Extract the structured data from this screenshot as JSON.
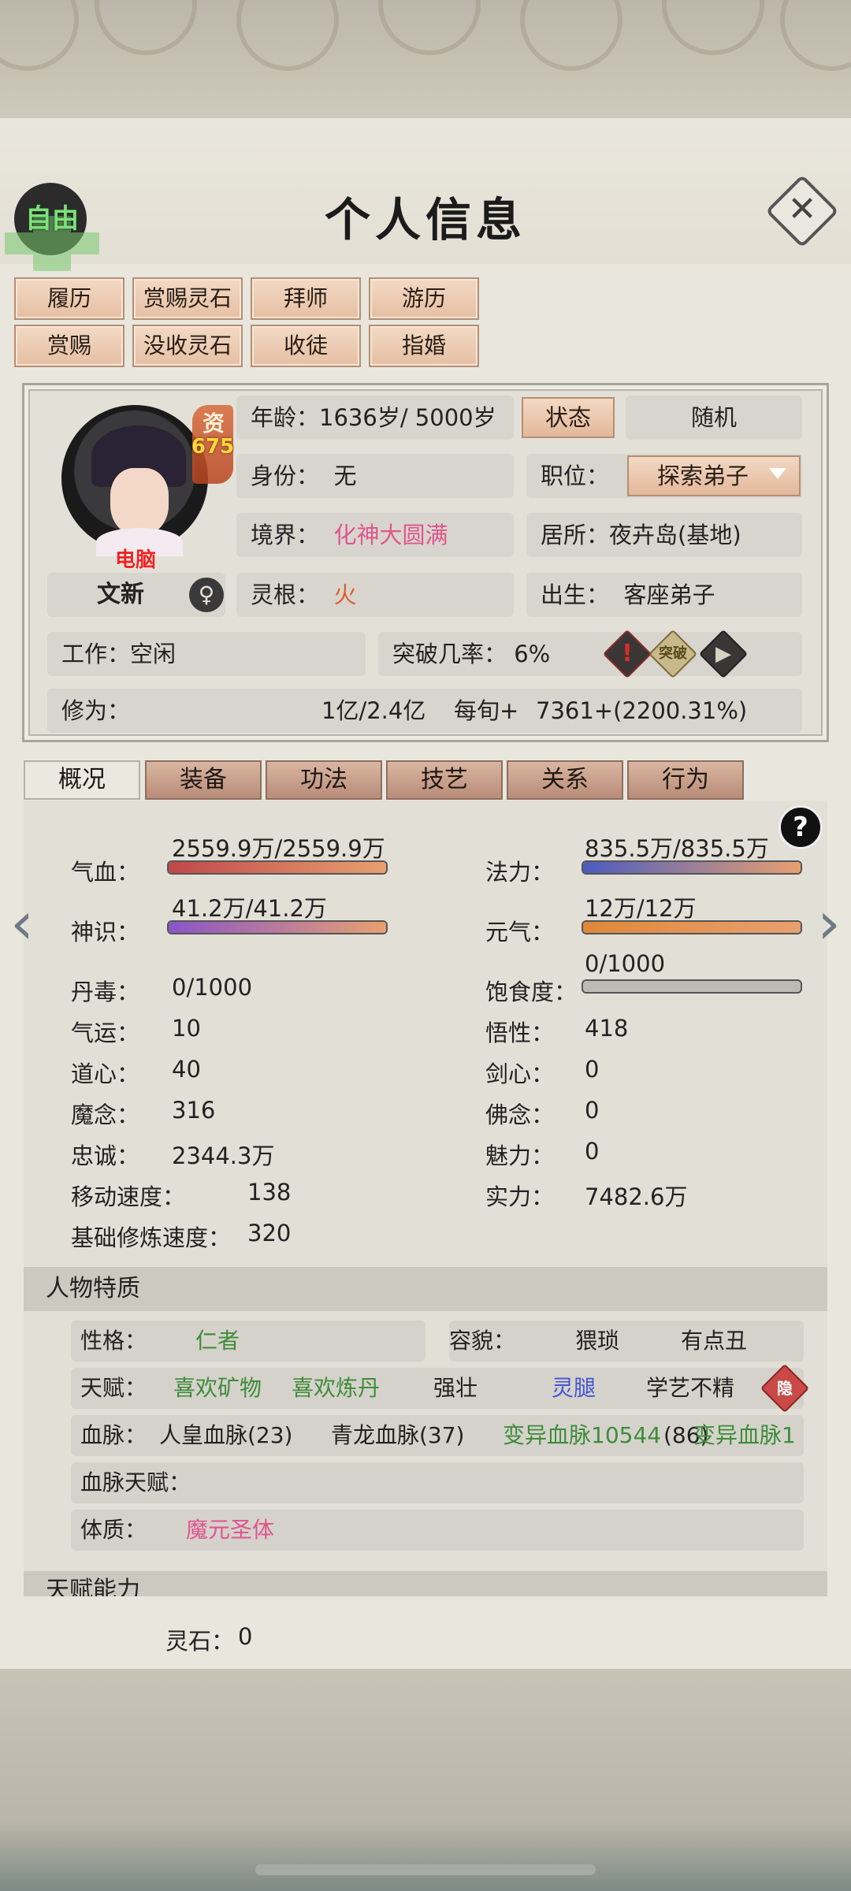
{
  "header": {
    "title": "个人信息",
    "free_badge": "自由",
    "close_icon": "close-x"
  },
  "actions": [
    {
      "label": "履历"
    },
    {
      "label": "赏赐灵石"
    },
    {
      "label": "拜师"
    },
    {
      "label": "游历"
    },
    {
      "label": "赏赐"
    },
    {
      "label": "没收灵石"
    },
    {
      "label": "收徒"
    },
    {
      "label": "指婚"
    }
  ],
  "profile": {
    "aptitude_char": "资",
    "aptitude_value": "675",
    "tag": "电脑",
    "name": "文新",
    "gender_icon": "♀",
    "age_label": "年龄：",
    "age_value": "1636岁/ 5000岁",
    "status_button": "状态",
    "random_button": "随机",
    "identity_label": "身份：",
    "identity_value": "无",
    "position_label": "职位：",
    "position_value": "探索弟子",
    "realm_label": "境界：",
    "realm_value": "化神大圆满",
    "residence_label": "居所：",
    "residence_value": "夜卉岛(基地)",
    "root_label": "灵根：",
    "root_value": "火",
    "origin_label": "出生：",
    "origin_value": "客座弟子",
    "work_label": "工作：",
    "work_value": "空闲",
    "breakthrough_label": "突破几率：",
    "breakthrough_value": "6%",
    "cultivation_label": "修为：",
    "cultivation_value": "1亿/2.4亿",
    "per_turn_label": "每旬+",
    "per_turn_value": "7361+(2200.31%)",
    "warning_icon": "!",
    "scroll_icon": "突破",
    "play_icon": "▶"
  },
  "tabs": [
    {
      "label": "概况"
    },
    {
      "label": "装备"
    },
    {
      "label": "功法"
    },
    {
      "label": "技艺"
    },
    {
      "label": "关系"
    },
    {
      "label": "行为"
    }
  ],
  "stats": {
    "help": "?",
    "hp_label": "气血：",
    "hp_text": "2559.9万/2559.9万",
    "hp_fraction": 1.0,
    "mana_label": "法力：",
    "mana_text": "835.5万/835.5万",
    "mana_fraction": 1.0,
    "sense_label": "神识：",
    "sense_text": "41.2万/41.2万",
    "sense_fraction": 1.0,
    "vital_label": "元气：",
    "vital_text": "12万/12万",
    "vital_fraction": 1.0,
    "poison_label": "丹毒：",
    "poison_value": "0/1000",
    "satiety_label": "饱食度：",
    "satiety_text": "0/1000",
    "satiety_fraction": 0,
    "luck_label": "气运：",
    "luck_value": "10",
    "comprehension_label": "悟性：",
    "comprehension_value": "418",
    "dao_label": "道心：",
    "dao_value": "40",
    "sword_label": "剑心：",
    "sword_value": "0",
    "demon_label": "魔念：",
    "demon_value": "316",
    "buddha_label": "佛念：",
    "buddha_value": "0",
    "loyalty_label": "忠诚：",
    "loyalty_value": "2344.3万",
    "charm_label": "魅力：",
    "charm_value": "0",
    "speed_label": "移动速度：",
    "speed_value": "138",
    "power_label": "实力：",
    "power_value": "7482.6万",
    "base_speed_label": "基础修炼速度：",
    "base_speed_value": "320",
    "colors": {
      "hp": "#c0484a",
      "mana": "#4c5cc0",
      "sense": "#8a55c8",
      "vital": "#e0883a"
    }
  },
  "traits": {
    "section_title": "人物特质",
    "personality_label": "性格：",
    "personality_value": "仁者",
    "appearance_label": "容貌：",
    "appearance_value_1": "猥琐",
    "appearance_value_2": "有点丑",
    "talent_label": "天赋：",
    "talent_1": "喜欢矿物",
    "talent_2": "喜欢炼丹",
    "talent_3": "强壮",
    "talent_4": "灵腿",
    "talent_5": "学艺不精",
    "hidden_icon": "隐",
    "bloodline_label": "血脉：",
    "bloodline_1": "人皇血脉(23)",
    "bloodline_2": "青龙血脉(37)",
    "bloodline_3": "变异血脉10544",
    "bloodline_4": "(86)",
    "bloodline_5": "变异血脉1",
    "bloodline_talent_label": "血脉天赋：",
    "physique_label": "体质：",
    "physique_value": "魔元圣体",
    "next_section": "天赋能力"
  },
  "footer": {
    "spirit_stone_label": "灵石：",
    "spirit_stone_value": "0"
  }
}
